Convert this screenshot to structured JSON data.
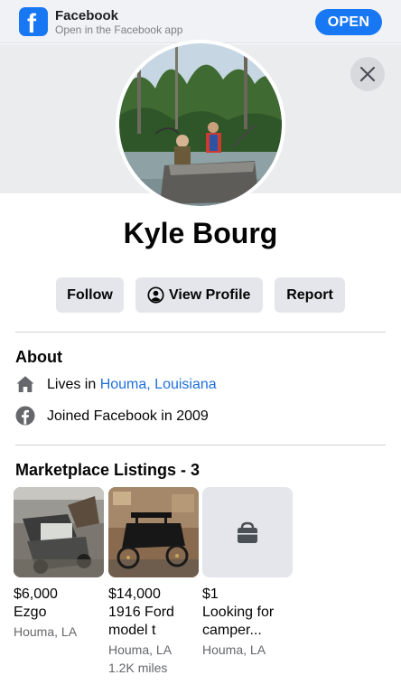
{
  "banner": {
    "app_name": "Facebook",
    "subtitle": "Open in the Facebook app",
    "open_label": "OPEN"
  },
  "profile": {
    "name": "Kyle Bourg"
  },
  "actions": {
    "follow_label": "Follow",
    "view_profile_label": "View Profile",
    "report_label": "Report"
  },
  "about": {
    "title": "About",
    "lives_in_prefix": "Lives in",
    "lives_in_place": "Houma, Louisiana",
    "joined": "Joined Facebook in 2009"
  },
  "marketplace": {
    "title": "Marketplace Listings - 3",
    "listings": [
      {
        "price": "$6,000",
        "title_lines": [
          "Ezgo"
        ],
        "location": "Houma, LA",
        "extra": ""
      },
      {
        "price": "$14,000",
        "title_lines": [
          "1916 Ford",
          "model t"
        ],
        "location": "Houma, LA",
        "extra": "1.2K miles"
      },
      {
        "price": "$1",
        "title_lines": [
          "Looking for",
          "camper..."
        ],
        "location": "Houma, LA",
        "extra": ""
      }
    ]
  },
  "colors": {
    "brand": "#1877f2",
    "link": "#216fdb",
    "button_bg": "#e4e6eb"
  }
}
